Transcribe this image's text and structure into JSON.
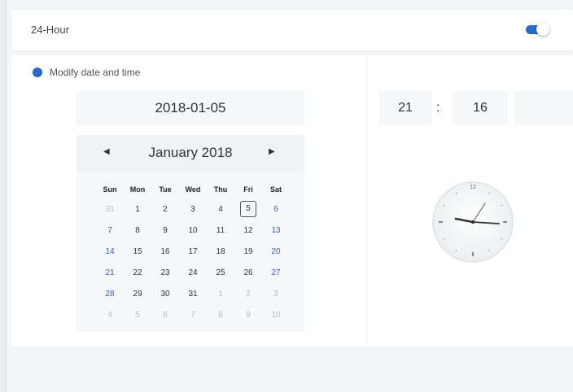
{
  "toggle_row": {
    "label": "24-Hour",
    "enabled": true,
    "accent": "#2868c8"
  },
  "mode": {
    "label": "Modify date and time"
  },
  "date": {
    "value": "2018-01-05"
  },
  "calendar": {
    "month_label": "January 2018",
    "prev_icon": "caret-left-icon",
    "next_icon": "caret-right-icon",
    "weekdays": [
      "Sun",
      "Mon",
      "Tue",
      "Wed",
      "Thu",
      "Fri",
      "Sat"
    ],
    "weeks": [
      [
        "31",
        "1",
        "2",
        "3",
        "4",
        "5",
        "6"
      ],
      [
        "7",
        "8",
        "9",
        "10",
        "11",
        "12",
        "13"
      ],
      [
        "14",
        "15",
        "16",
        "17",
        "18",
        "19",
        "20"
      ],
      [
        "21",
        "22",
        "23",
        "24",
        "25",
        "26",
        "27"
      ],
      [
        "28",
        "29",
        "30",
        "31",
        "1",
        "2",
        "3"
      ],
      [
        "4",
        "5",
        "6",
        "7",
        "8",
        "9",
        "10"
      ]
    ],
    "selected_day": "5"
  },
  "time": {
    "hour": "21",
    "separator": ":",
    "minute": "16",
    "second": ""
  },
  "clock": {
    "numeral_12": "12"
  }
}
